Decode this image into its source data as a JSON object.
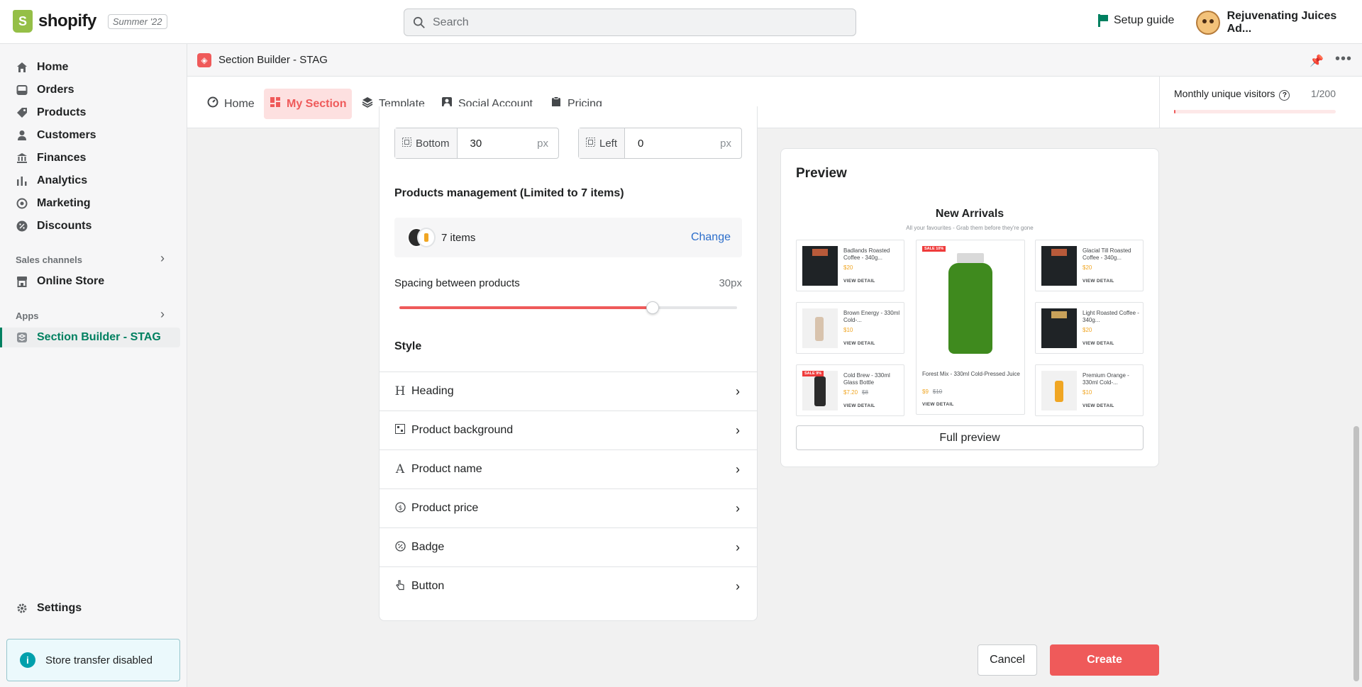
{
  "topbar": {
    "logo_text": "shopify",
    "edition": "Summer '22",
    "search_placeholder": "Search",
    "setup_guide": "Setup guide",
    "account_name": "Rejuvenating Juices Ad..."
  },
  "sidebar": {
    "items": [
      {
        "label": "Home",
        "icon": "home-icon"
      },
      {
        "label": "Orders",
        "icon": "orders-icon"
      },
      {
        "label": "Products",
        "icon": "tag-icon"
      },
      {
        "label": "Customers",
        "icon": "person-icon"
      },
      {
        "label": "Finances",
        "icon": "bank-icon"
      },
      {
        "label": "Analytics",
        "icon": "bar-chart-icon"
      },
      {
        "label": "Marketing",
        "icon": "target-icon"
      },
      {
        "label": "Discounts",
        "icon": "discount-icon"
      }
    ],
    "sales_channels_title": "Sales channels",
    "online_store": "Online Store",
    "apps_title": "Apps",
    "active_app": "Section Builder - STAG",
    "settings": "Settings",
    "store_transfer": "Store transfer disabled"
  },
  "app": {
    "title": "Section Builder - STAG",
    "tabs": [
      {
        "label": "Home",
        "icon": "home-icon"
      },
      {
        "label": "My Section",
        "icon": "grid-icon"
      },
      {
        "label": "Template",
        "icon": "layers-icon"
      },
      {
        "label": "Social Account",
        "icon": "person-badge-icon"
      },
      {
        "label": "Pricing",
        "icon": "clipboard-icon"
      }
    ],
    "visitors_label": "Monthly unique visitors",
    "visitors_count": "1/200",
    "visitors_fraction": 0.005
  },
  "settings_panel": {
    "bottom_label": "Bottom",
    "bottom_value": "30",
    "left_label": "Left",
    "left_value": "0",
    "unit": "px",
    "products_title": "Products management (Limited to 7 items)",
    "items_count": "7 items",
    "change_label": "Change",
    "spacing_label": "Spacing between products",
    "spacing_value": "30px",
    "spacing_fraction": 0.75,
    "style_title": "Style",
    "style_rows": [
      {
        "label": "Heading",
        "icon": "heading-icon"
      },
      {
        "label": "Product background",
        "icon": "background-icon"
      },
      {
        "label": "Product name",
        "icon": "text-icon"
      },
      {
        "label": "Product price",
        "icon": "dollar-icon"
      },
      {
        "label": "Badge",
        "icon": "badge-icon"
      },
      {
        "label": "Button",
        "icon": "pointer-icon"
      }
    ]
  },
  "preview": {
    "title": "Preview",
    "heading": "New Arrivals",
    "subheading": "All your favourites - Grab them before they're gone",
    "view_detail": "VIEW DETAIL",
    "products": [
      {
        "name": "Badlands Roasted Coffee - 340g...",
        "price": "$20",
        "old_price": "",
        "badge": ""
      },
      {
        "name": "Brown Energy - 330ml Cold-...",
        "price": "$10",
        "old_price": "",
        "badge": ""
      },
      {
        "name": "Cold Brew - 330ml Glass Bottle",
        "price": "$7.20",
        "old_price": "$8",
        "badge": "SALE 9%"
      },
      {
        "name": "Glacial Till Roasted Coffee - 340g...",
        "price": "$20",
        "old_price": "",
        "badge": ""
      },
      {
        "name": "Light Roasted Coffee - 340g...",
        "price": "$20",
        "old_price": "",
        "badge": ""
      },
      {
        "name": "Premium Orange - 330ml Cold-...",
        "price": "$10",
        "old_price": "",
        "badge": ""
      }
    ],
    "featured": {
      "name": "Forest Mix - 330ml Cold-Pressed Juice",
      "price": "$9",
      "old_price": "$10",
      "badge": "SALE 10%"
    },
    "full_preview": "Full preview"
  },
  "footer": {
    "cancel": "Cancel",
    "create": "Create"
  },
  "colors": {
    "accent": "#ef5a5a",
    "shopify_green": "#008060",
    "link": "#2c6ecb"
  }
}
